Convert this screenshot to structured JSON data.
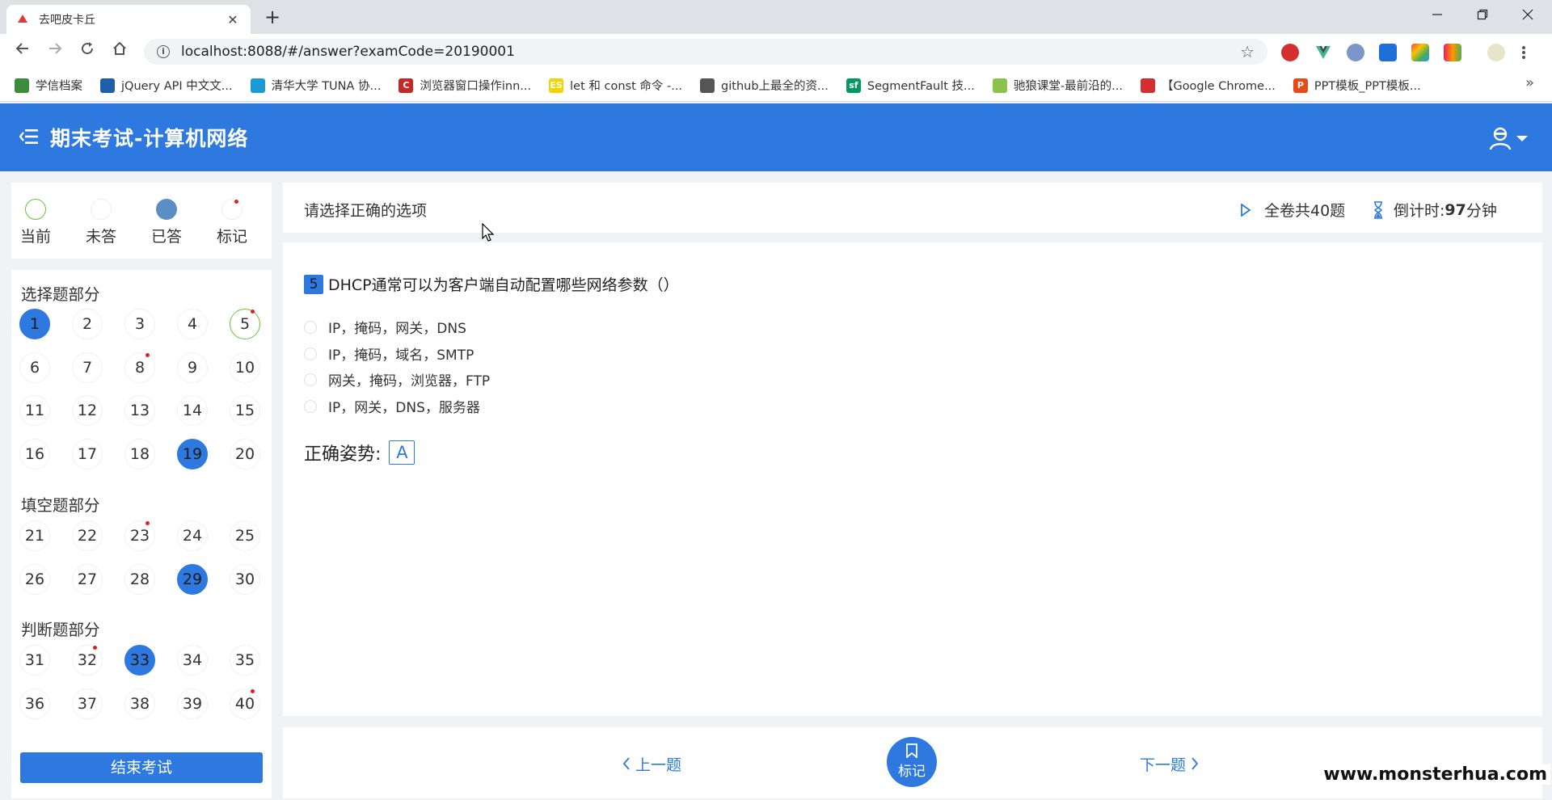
{
  "browser": {
    "tab_title": "去吧皮卡丘",
    "tab_close": "✕",
    "new_tab": "+",
    "url": "localhost:8088/#/answer?examCode=20190001",
    "bookmarks": [
      {
        "label": "学信档案",
        "color": "#3a8d3a"
      },
      {
        "label": "jQuery API 中文文...",
        "color": "#1f5fa8"
      },
      {
        "label": "清华大学 TUNA 协...",
        "color": "#1a9bd7"
      },
      {
        "label": "浏览器窗口操作inn...",
        "color": "#c62828",
        "icon_text": "C"
      },
      {
        "label": "let 和 const 命令 -...",
        "color": "#f5d300",
        "icon_text": "ES"
      },
      {
        "label": "github上最全的资...",
        "color": "#555555"
      },
      {
        "label": "SegmentFault 技...",
        "color": "#009a61",
        "icon_text": "sf"
      },
      {
        "label": "驰狼课堂-最前沿的...",
        "color": "#8bc34a"
      },
      {
        "label": "【Google Chrome...",
        "color": "#d32f2f"
      },
      {
        "label": "PPT模板_PPT模板...",
        "color": "#e64a19",
        "icon_text": "P"
      }
    ],
    "bookmarks_more": "»"
  },
  "header": {
    "title": "期末考试-计算机网络"
  },
  "legend": [
    {
      "label": "当前",
      "type": "current"
    },
    {
      "label": "未答",
      "type": "unanswered"
    },
    {
      "label": "已答",
      "type": "answered"
    },
    {
      "label": "标记",
      "type": "marked"
    }
  ],
  "sections": [
    {
      "title": "选择题部分",
      "rows": [
        [
          {
            "n": "1",
            "s": "answered"
          },
          {
            "n": "2"
          },
          {
            "n": "3"
          },
          {
            "n": "4"
          },
          {
            "n": "5",
            "s": "current",
            "mark": true
          }
        ],
        [
          {
            "n": "6"
          },
          {
            "n": "7"
          },
          {
            "n": "8",
            "mark": true
          },
          {
            "n": "9"
          },
          {
            "n": "10"
          }
        ],
        [
          {
            "n": "11"
          },
          {
            "n": "12"
          },
          {
            "n": "13"
          },
          {
            "n": "14"
          },
          {
            "n": "15"
          }
        ],
        [
          {
            "n": "16"
          },
          {
            "n": "17"
          },
          {
            "n": "18"
          },
          {
            "n": "19",
            "s": "answered"
          },
          {
            "n": "20"
          }
        ]
      ]
    },
    {
      "title": "填空题部分",
      "rows": [
        [
          {
            "n": "21"
          },
          {
            "n": "22"
          },
          {
            "n": "23",
            "mark": true
          },
          {
            "n": "24"
          },
          {
            "n": "25"
          }
        ],
        [
          {
            "n": "26"
          },
          {
            "n": "27"
          },
          {
            "n": "28"
          },
          {
            "n": "29",
            "s": "answered"
          },
          {
            "n": "30"
          }
        ]
      ]
    },
    {
      "title": "判断题部分",
      "rows": [
        [
          {
            "n": "31"
          },
          {
            "n": "32",
            "mark": true
          },
          {
            "n": "33",
            "s": "answered"
          },
          {
            "n": "34"
          },
          {
            "n": "35"
          }
        ],
        [
          {
            "n": "36"
          },
          {
            "n": "37"
          },
          {
            "n": "38"
          },
          {
            "n": "39"
          },
          {
            "n": "40",
            "mark": true
          }
        ]
      ]
    }
  ],
  "end_exam_label": "结束考试",
  "info": {
    "hint": "请选择正确的选项",
    "total": "全卷共40题",
    "timer_prefix": "倒计时:",
    "timer_value": "97",
    "timer_unit": "分钟"
  },
  "question": {
    "number": "5",
    "text": "DHCP通常可以为客户端自动配置哪些网络参数（）",
    "options": [
      "IP，掩码，网关，DNS",
      "IP，掩码，域名，SMTP",
      "网关，掩码，浏览器，FTP",
      "IP，网关，DNS，服务器"
    ],
    "answer_label": "正确姿势:",
    "answer_value": "A"
  },
  "footer": {
    "prev": "上一题",
    "mark": "标记",
    "next": "下一题"
  },
  "watermark": "www.monsterhua.com",
  "colors": {
    "primary": "#2d79e0",
    "current_ring": "#67c23a",
    "mark_dot": "#e02020",
    "answered_legend": "#5b8ec4"
  }
}
